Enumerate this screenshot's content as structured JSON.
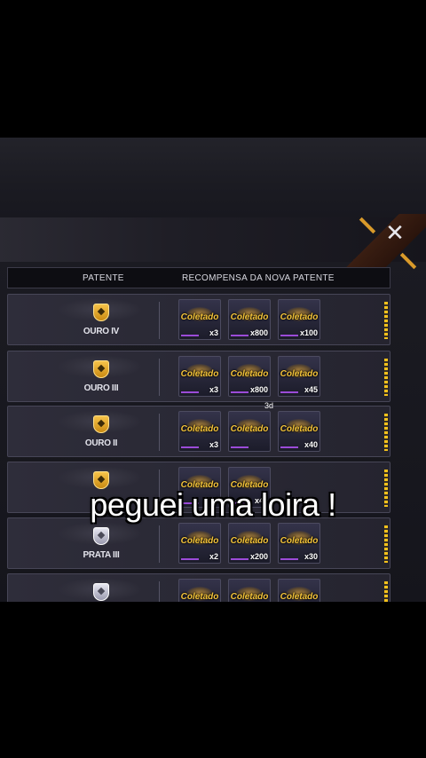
{
  "header": {
    "col_rank": "PATENTE",
    "col_reward": "RECOMPENSA DA NOVA PATENTE"
  },
  "close_icon": "close-icon",
  "colors": {
    "accent_gold": "#f2c23a",
    "progress": "#f4c21c",
    "panel": "#2a2935"
  },
  "rows": [
    {
      "rank": "OURO IV",
      "tier": "gold",
      "rewards": [
        {
          "status": "Coletado",
          "qty": "x3"
        },
        {
          "status": "Coletado",
          "qty": "x800"
        },
        {
          "status": "Coletado",
          "qty": "x100"
        }
      ]
    },
    {
      "rank": "OURO III",
      "tier": "gold",
      "rewards": [
        {
          "status": "Coletado",
          "qty": "x3"
        },
        {
          "status": "Coletado",
          "qty": "x800"
        },
        {
          "status": "Coletado",
          "qty": "x45"
        }
      ]
    },
    {
      "rank": "OURO II",
      "tier": "gold",
      "rewards": [
        {
          "status": "Coletado",
          "qty": "x3"
        },
        {
          "status": "Coletado",
          "qty": "",
          "tag": "3d"
        },
        {
          "status": "Coletado",
          "qty": "x40"
        }
      ]
    },
    {
      "rank": "",
      "tier": "gold",
      "rewards": [
        {
          "status": "Coletado",
          "qty": ""
        },
        {
          "status": "Coletado",
          "qty": "x40"
        }
      ]
    },
    {
      "rank": "PRATA III",
      "tier": "silver",
      "rewards": [
        {
          "status": "Coletado",
          "qty": "x2"
        },
        {
          "status": "Coletado",
          "qty": "x200"
        },
        {
          "status": "Coletado",
          "qty": "x30"
        }
      ]
    },
    {
      "rank": "",
      "tier": "silver",
      "rewards": [
        {
          "status": "Coletado",
          "qty": ""
        },
        {
          "status": "Coletado",
          "qty": ""
        },
        {
          "status": "Coletado",
          "qty": ""
        }
      ]
    }
  ],
  "caption": "peguei uma loira !"
}
